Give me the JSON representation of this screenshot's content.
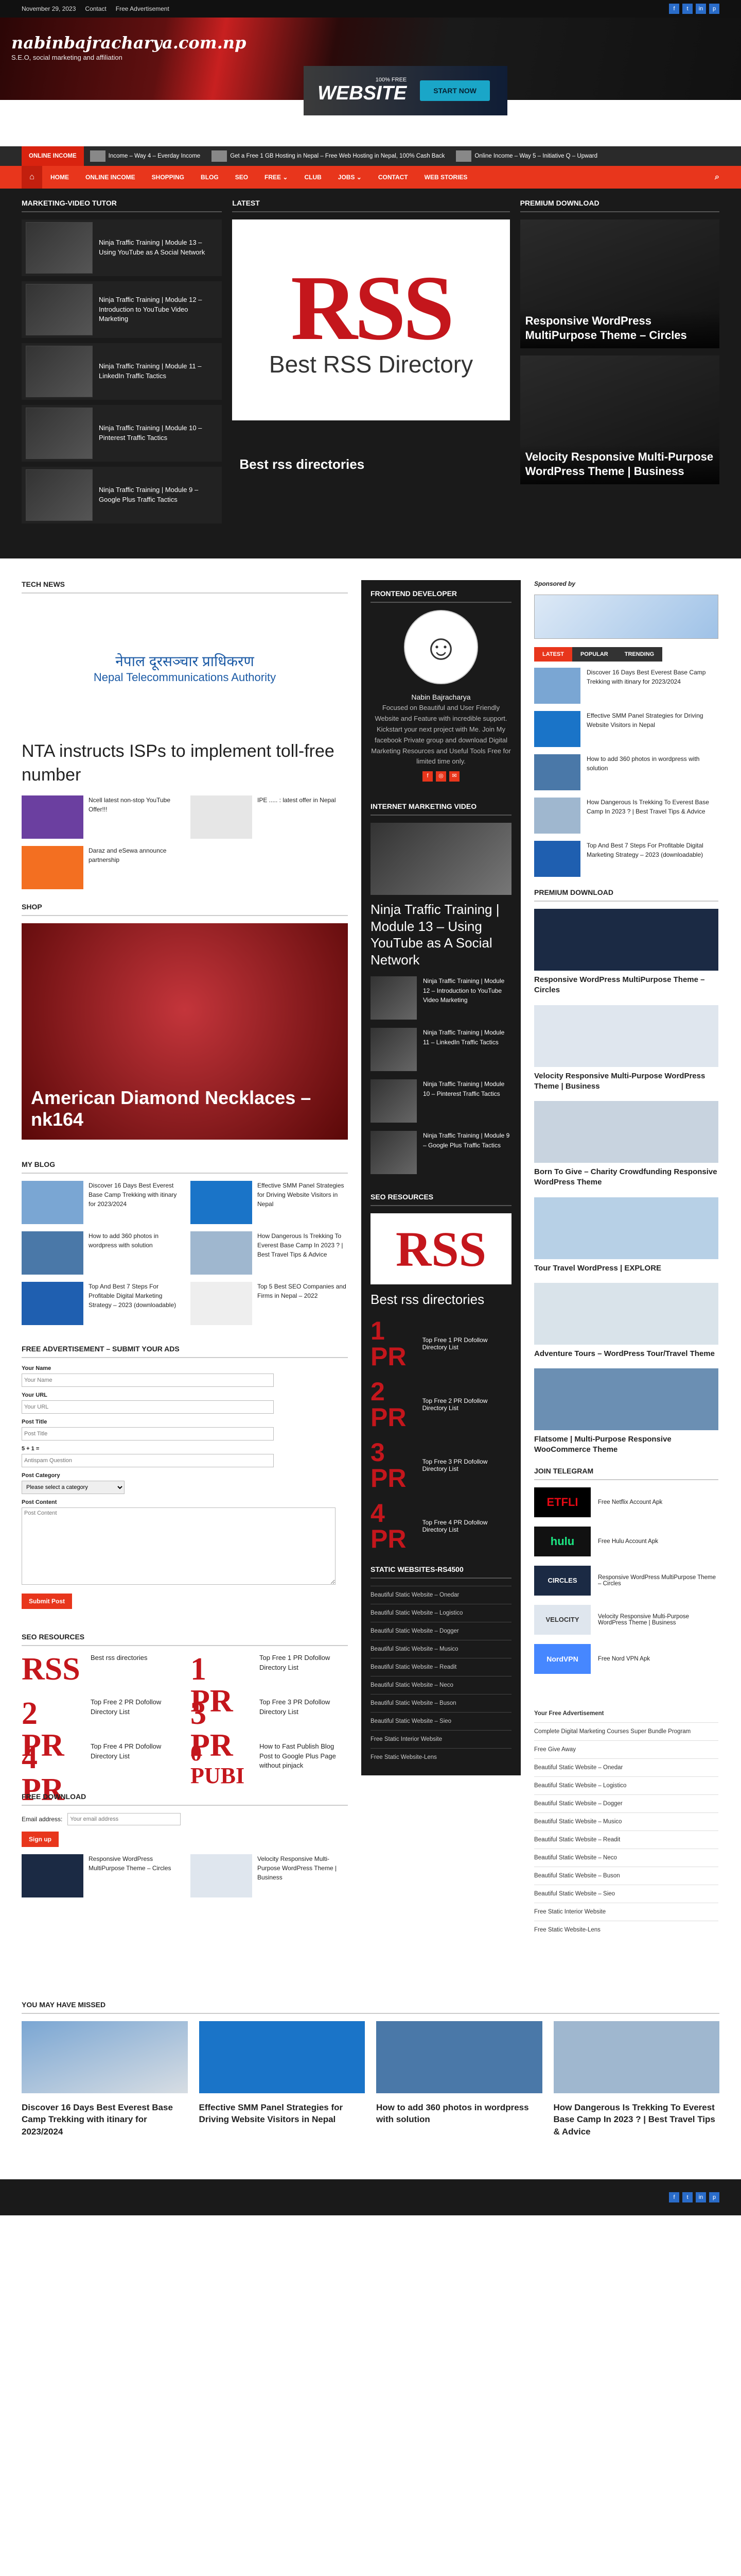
{
  "topbar": {
    "date": "November 29, 2023",
    "links": [
      "Contact",
      "Free Advertisement"
    ]
  },
  "header": {
    "logo": "nabinbajracharya.com.np",
    "tagline": "S.E.O, social marketing and affiliation",
    "banner": {
      "line1": "100% FREE",
      "big": "WEBSITE",
      "cta": "START NOW"
    }
  },
  "ticker": {
    "label": "ONLINE INCOME",
    "items": [
      "Income – Way 4 – Everday Income",
      "Get a Free 1 GB Hosting in Nepal – Free Web Hosting in Nepal, 100% Cash Back",
      "Online Income – Way 5 – Initiative Q – Upward"
    ]
  },
  "nav": [
    "HOME",
    "ONLINE INCOME",
    "SHOPPING",
    "BLOG",
    "SEO",
    "FREE ⌄",
    "CLUB",
    "JOBS ⌄",
    "CONTACT",
    "WEB STORIES"
  ],
  "top": {
    "mkt_title": "MARKETING-VIDEO TUTOR",
    "mkt": [
      "Ninja Traffic Training | Module 13 – Using YouTube as A Social Network",
      "Ninja Traffic Training | Module 12 – Introduction to YouTube Video Marketing",
      "Ninja Traffic Training | Module 11 – LinkedIn Traffic Tactics",
      "Ninja Traffic Training | Module 10 – Pinterest Traffic Tactics",
      "Ninja Traffic Training | Module 9 – Google Plus Traffic Tactics"
    ],
    "latest_title": "LATEST",
    "rss": "RSS",
    "rss_sub": "Best RSS Directory",
    "latest_cap": "Best rss directories",
    "prem_title": "PREMIUM DOWNLOAD",
    "prem": [
      "Responsive WordPress MultiPurpose Theme – Circles",
      "Velocity Responsive Multi-Purpose WordPress Theme | Business"
    ]
  },
  "left": {
    "tech_title": "TECH NEWS",
    "nta1": "नेपाल दूरसञ्चार प्राधिकरण",
    "nta2": "Nepal Telecommunications Authority",
    "tech_head": "NTA instructs ISPs to implement toll-free number",
    "tech_minis": [
      "Ncell latest non-stop YouTube Offer!!!",
      "IPE ..... : latest offer in Nepal",
      "Daraz and eSewa announce partnership"
    ],
    "shop_title": "SHOP",
    "shop_cap": "American Diamond Necklaces – nk164",
    "blog_title": "MY BLOG",
    "blog": [
      "Discover 16 Days Best Everest Base Camp Trekking with itinary for 2023/2024",
      "Effective SMM Panel Strategies for Driving Website Visitors in Nepal",
      "How to add 360 photos in wordpress with solution",
      "How Dangerous Is Trekking To Everest Base Camp In 2023 ? | Best Travel Tips & Advice",
      "Top And Best 7 Steps For Profitable Digital Marketing Strategy – 2023 (downloadable)",
      "Top 5 Best SEO Companies and Firms in Nepal – 2022"
    ],
    "ad_title": "FREE ADVERTISEMENT – SUBMIT YOUR ADS",
    "form": {
      "name": "Your Name",
      "name_ph": "Your Name",
      "url": "Your URL",
      "url_ph": "Your URL",
      "title": "Post Title",
      "title_ph": "Post Title",
      "captcha": "5 + 1 =",
      "captcha_ph": "Antispam Question",
      "cat": "Post Category",
      "cat_sel": "Please select a category",
      "content": "Post Content",
      "content_ph": "Post Content",
      "submit": "Submit Post"
    },
    "seo_title": "SEO RESOURCES",
    "seo": [
      {
        "logo": "RSS",
        "t": "Best rss directories"
      },
      {
        "logo": "1 PR",
        "t": "Top Free 1 PR Dofollow Directory List"
      },
      {
        "logo": "2 PR",
        "t": "Top Free 2 PR Dofollow Directory List"
      },
      {
        "logo": "3 PR",
        "t": "Top Free 3 PR Dofollow Directory List"
      },
      {
        "logo": "4 PR",
        "t": "Top Free 4 PR Dofollow Directory List"
      },
      {
        "logo": "0 PUBI",
        "t": "How to Fast Publish Blog Post to Google Plus Page without pinjack"
      }
    ],
    "dl_title": "FREE DOWNLOAD",
    "email_label": "Email address:",
    "email_ph": "Your email address",
    "signup": "Sign up",
    "dl": [
      "Responsive WordPress MultiPurpose Theme – Circles",
      "Velocity Responsive Multi-Purpose WordPress Theme | Business"
    ]
  },
  "mid": {
    "fd_title": "FRONTEND DEVELOPER",
    "name": "Nabin Bajracharya",
    "bio": "Focused on Beautiful and User Friendly Website and Feature with incredible support. Kickstart your next project with Me. Join My facebook Private group and download Digital Marketing Resources and Useful Tools Free for limited time only.",
    "imv_title": "INTERNET MARKETING VIDEO",
    "imv_head": "Ninja Traffic Training | Module 13 – Using YouTube as A Social Network",
    "imv": [
      "Ninja Traffic Training | Module 12 – Introduction to YouTube Video Marketing",
      "Ninja Traffic Training | Module 11 – LinkedIn Traffic Tactics",
      "Ninja Traffic Training | Module 10 – Pinterest Traffic Tactics",
      "Ninja Traffic Training | Module 9 – Google Plus Traffic Tactics"
    ],
    "seo_title": "SEO RESOURCES",
    "rss": "RSS",
    "rss_head": "Best rss directories",
    "pr": [
      {
        "n": "1 PR",
        "t": "Top Free 1 PR Dofollow Directory List"
      },
      {
        "n": "2 PR",
        "t": "Top Free 2 PR Dofollow Directory List"
      },
      {
        "n": "3 PR",
        "t": "Top Free 3 PR Dofollow Directory List"
      },
      {
        "n": "4 PR",
        "t": "Top Free 4 PR Dofollow Directory List"
      }
    ],
    "sw_title": "STATIC WEBSITES-RS4500",
    "sw": [
      "Beautiful Static Website – Onedar",
      "Beautiful Static Website – Logistico",
      "Beautiful Static Website – Dogger",
      "Beautiful Static Website – Musico",
      "Beautiful Static Website – Readit",
      "Beautiful Static Website – Neco",
      "Beautiful Static Website – Buson",
      "Beautiful Static Website – Sieo",
      "Free Static Interior Website",
      "Free Static Website-Lens"
    ]
  },
  "right": {
    "sponsor": "Sponsored by",
    "tabs": [
      "LATEST",
      "POPULAR",
      "TRENDING"
    ],
    "list": [
      "Discover 16 Days Best Everest Base Camp Trekking with itinary for 2023/2024",
      "Effective SMM Panel Strategies for Driving Website Visitors in Nepal",
      "How to add 360 photos in wordpress with solution",
      "How Dangerous Is Trekking To Everest Base Camp In 2023 ? | Best Travel Tips & Advice",
      "Top And Best 7 Steps For Profitable Digital Marketing Strategy – 2023 (downloadable)"
    ],
    "pd_title": "PREMIUM DOWNLOAD",
    "pd": [
      "Responsive WordPress MultiPurpose Theme – Circles",
      "Velocity Responsive Multi-Purpose WordPress Theme | Business",
      "Born To Give – Charity Crowdfunding Responsive WordPress Theme",
      "Tour Travel WordPress | EXPLORE",
      "Adventure Tours – WordPress Tour/Travel Theme",
      "Flatsome | Multi-Purpose Responsive WooCommerce Theme"
    ],
    "tg_title": "JOIN TELEGRAM",
    "tg": [
      {
        "l": "ETFLI",
        "t": "Free Netflix Account Apk",
        "c": "#e50914"
      },
      {
        "l": "hulu",
        "t": "Free Hulu Account Apk",
        "c": "#1ce783"
      },
      {
        "l": "CIRCLES",
        "t": "Responsive WordPress MultiPurpose Theme – Circles",
        "c": "#2a7bd1"
      },
      {
        "l": "VELOCITY",
        "t": "Velocity Responsive Multi-Purpose WordPress Theme | Business",
        "c": "#666"
      },
      {
        "l": "NordVPN",
        "t": "Free Nord VPN Apk",
        "c": "#4687ff"
      }
    ],
    "ad_t1": "Your Free Advertisement",
    "ad_t2": "Complete Digital Marketing Courses Super Bundle Program",
    "ad_t3": "Free Give Away",
    "links": [
      "Beautiful Static Website – Onedar",
      "Beautiful Static Website – Logistico",
      "Beautiful Static Website – Dogger",
      "Beautiful Static Website – Musico",
      "Beautiful Static Website – Readit",
      "Beautiful Static Website – Neco",
      "Beautiful Static Website – Buson",
      "Beautiful Static Website – Sieo",
      "Free Static Interior Website",
      "Free Static Website-Lens"
    ]
  },
  "missed": {
    "title": "YOU MAY HAVE MISSED",
    "items": [
      "Discover 16 Days Best Everest Base Camp Trekking with itinary for 2023/2024",
      "Effective SMM Panel Strategies for Driving Website Visitors in Nepal",
      "How to add 360 photos in wordpress with solution",
      "How Dangerous Is Trekking To Everest Base Camp In 2023 ? | Best Travel Tips & Advice"
    ]
  }
}
